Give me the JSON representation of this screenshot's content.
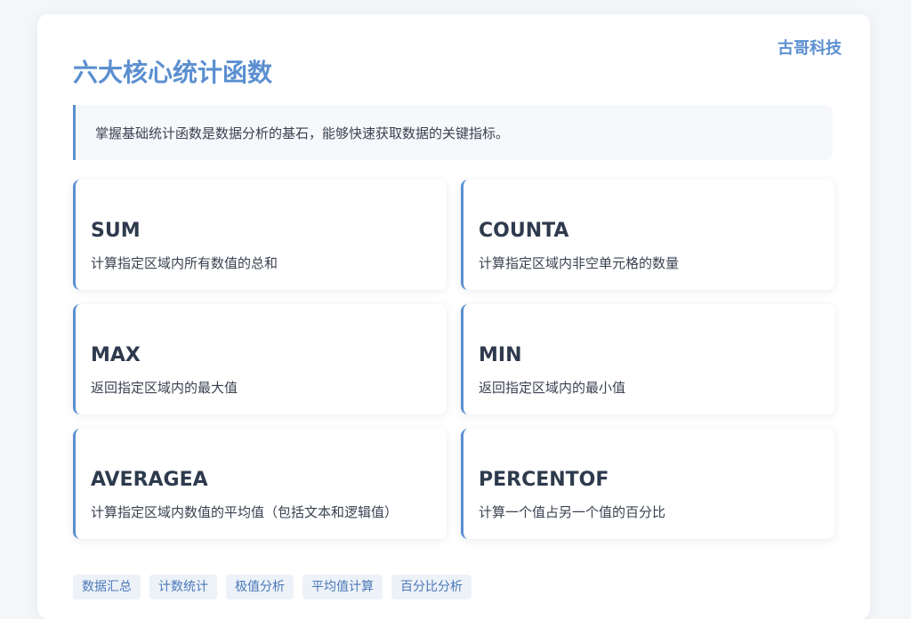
{
  "brand": "古哥科技",
  "title": "六大核心统计函数",
  "intro": "掌握基础统计函数是数据分析的基石，能够快速获取数据的关键指标。",
  "colors": {
    "accent": "#5b8fd0",
    "heading_text": "#2e3a4d",
    "body_text": "#3a4250",
    "tag_bg": "#edf2f8"
  },
  "functions": [
    {
      "name": "SUM",
      "desc": "计算指定区域内所有数值的总和"
    },
    {
      "name": "COUNTA",
      "desc": "计算指定区域内非空单元格的数量"
    },
    {
      "name": "MAX",
      "desc": "返回指定区域内的最大值"
    },
    {
      "name": "MIN",
      "desc": "返回指定区域内的最小值"
    },
    {
      "name": "AVERAGEA",
      "desc": "计算指定区域内数值的平均值（包括文本和逻辑值）"
    },
    {
      "name": "PERCENTOF",
      "desc": "计算一个值占另一个值的百分比"
    }
  ],
  "tags": [
    "数据汇总",
    "计数统计",
    "极值分析",
    "平均值计算",
    "百分比分析"
  ]
}
